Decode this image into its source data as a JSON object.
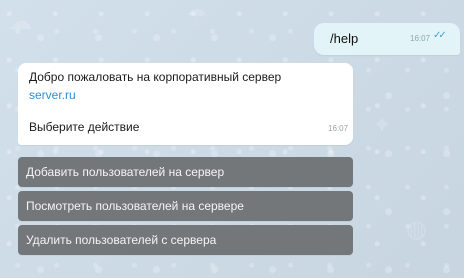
{
  "messages": {
    "outgoing": {
      "text": "/help",
      "time": "16:07",
      "status_icon": "double-check-icon"
    },
    "incoming": {
      "line1": "Добро пожаловать на корпоративный сервер",
      "link": "server.ru",
      "line2": "Выберите действие",
      "time": "16:07"
    }
  },
  "keyboard": {
    "buttons": [
      {
        "label": "Добавить пользователей на сервер"
      },
      {
        "label": "Посмотреть пользователей на сервере"
      },
      {
        "label": "Удалить пользователей с сервера"
      }
    ]
  },
  "colors": {
    "outgoing_bubble": "#e3f4f9",
    "incoming_bubble": "#ffffff",
    "link": "#2e8fd1",
    "button": "#74777a",
    "check": "#46a3d5"
  }
}
